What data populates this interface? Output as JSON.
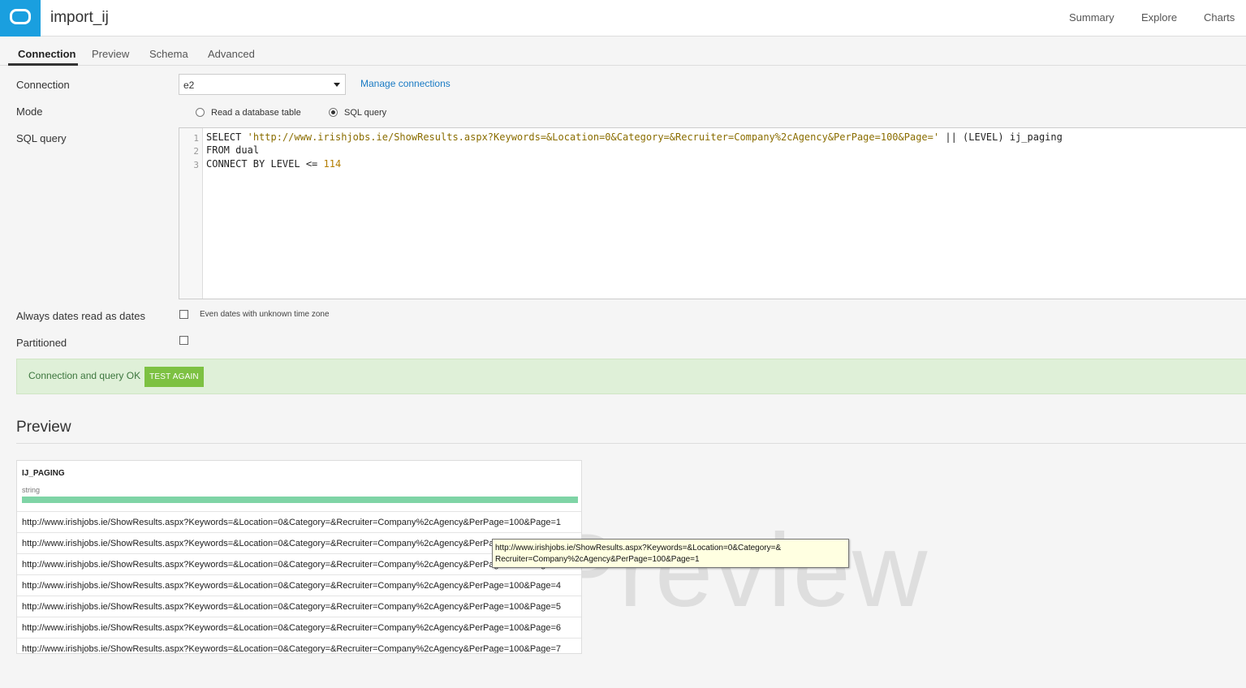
{
  "header": {
    "app_title": "import_ij",
    "nav": [
      "Summary",
      "Explore",
      "Charts"
    ]
  },
  "tabs": [
    "Connection",
    "Preview",
    "Schema",
    "Advanced"
  ],
  "form": {
    "connection_label": "Connection",
    "connection_value": "e2",
    "manage_link": "Manage connections",
    "mode_label": "Mode",
    "mode_options": [
      "Read a database table",
      "SQL query"
    ],
    "mode_selected": "SQL query",
    "sql_label": "SQL query",
    "sql_lines": {
      "l1_kw": "SELECT",
      "l1_str": "'http://www.irishjobs.ie/ShowResults.aspx?Keywords=&Location=0&Category=&Recruiter=Company%2cAgency&PerPage=100&Page='",
      "l1_rest": "|| (LEVEL) ij_paging",
      "l2_kw": "FROM",
      "l2_rest": "dual",
      "l3_kw": "CONNECT BY LEVEL <=",
      "l3_num": "114"
    },
    "line_numbers": [
      "1",
      "2",
      "3"
    ],
    "dates_label": "Always dates read as dates",
    "dates_note": "Even dates with unknown time zone",
    "partitioned_label": "Partitioned"
  },
  "status": {
    "text": "Connection and query OK",
    "button": "TEST AGAIN"
  },
  "preview": {
    "title": "Preview",
    "watermark": "Preview",
    "column": {
      "name": "IJ_PAGING",
      "type": "string"
    },
    "rows": [
      "http://www.irishjobs.ie/ShowResults.aspx?Keywords=&Location=0&Category=&Recruiter=Company%2cAgency&PerPage=100&Page=1",
      "http://www.irishjobs.ie/ShowResults.aspx?Keywords=&Location=0&Category=&Recruiter=Company%2cAgency&PerPage=100&Page=2",
      "http://www.irishjobs.ie/ShowResults.aspx?Keywords=&Location=0&Category=&Recruiter=Company%2cAgency&PerPage=100&Page=3",
      "http://www.irishjobs.ie/ShowResults.aspx?Keywords=&Location=0&Category=&Recruiter=Company%2cAgency&PerPage=100&Page=4",
      "http://www.irishjobs.ie/ShowResults.aspx?Keywords=&Location=0&Category=&Recruiter=Company%2cAgency&PerPage=100&Page=5",
      "http://www.irishjobs.ie/ShowResults.aspx?Keywords=&Location=0&Category=&Recruiter=Company%2cAgency&PerPage=100&Page=6",
      "http://www.irishjobs.ie/ShowResults.aspx?Keywords=&Location=0&Category=&Recruiter=Company%2cAgency&PerPage=100&Page=7"
    ],
    "tooltip_line1": "http://www.irishjobs.ie/ShowResults.aspx?Keywords=&Location=0&Category=&",
    "tooltip_line2": "Recruiter=Company%2cAgency&PerPage=100&Page=1"
  },
  "colors": {
    "brand": "#1a9fdf",
    "ok_bg": "#dff0d8",
    "ok_button": "#7dc142",
    "link": "#1a7bc4",
    "column_bar": "#7fd4a6"
  },
  "icons": [
    "app-logo-icon",
    "dropdown-caret-icon"
  ]
}
